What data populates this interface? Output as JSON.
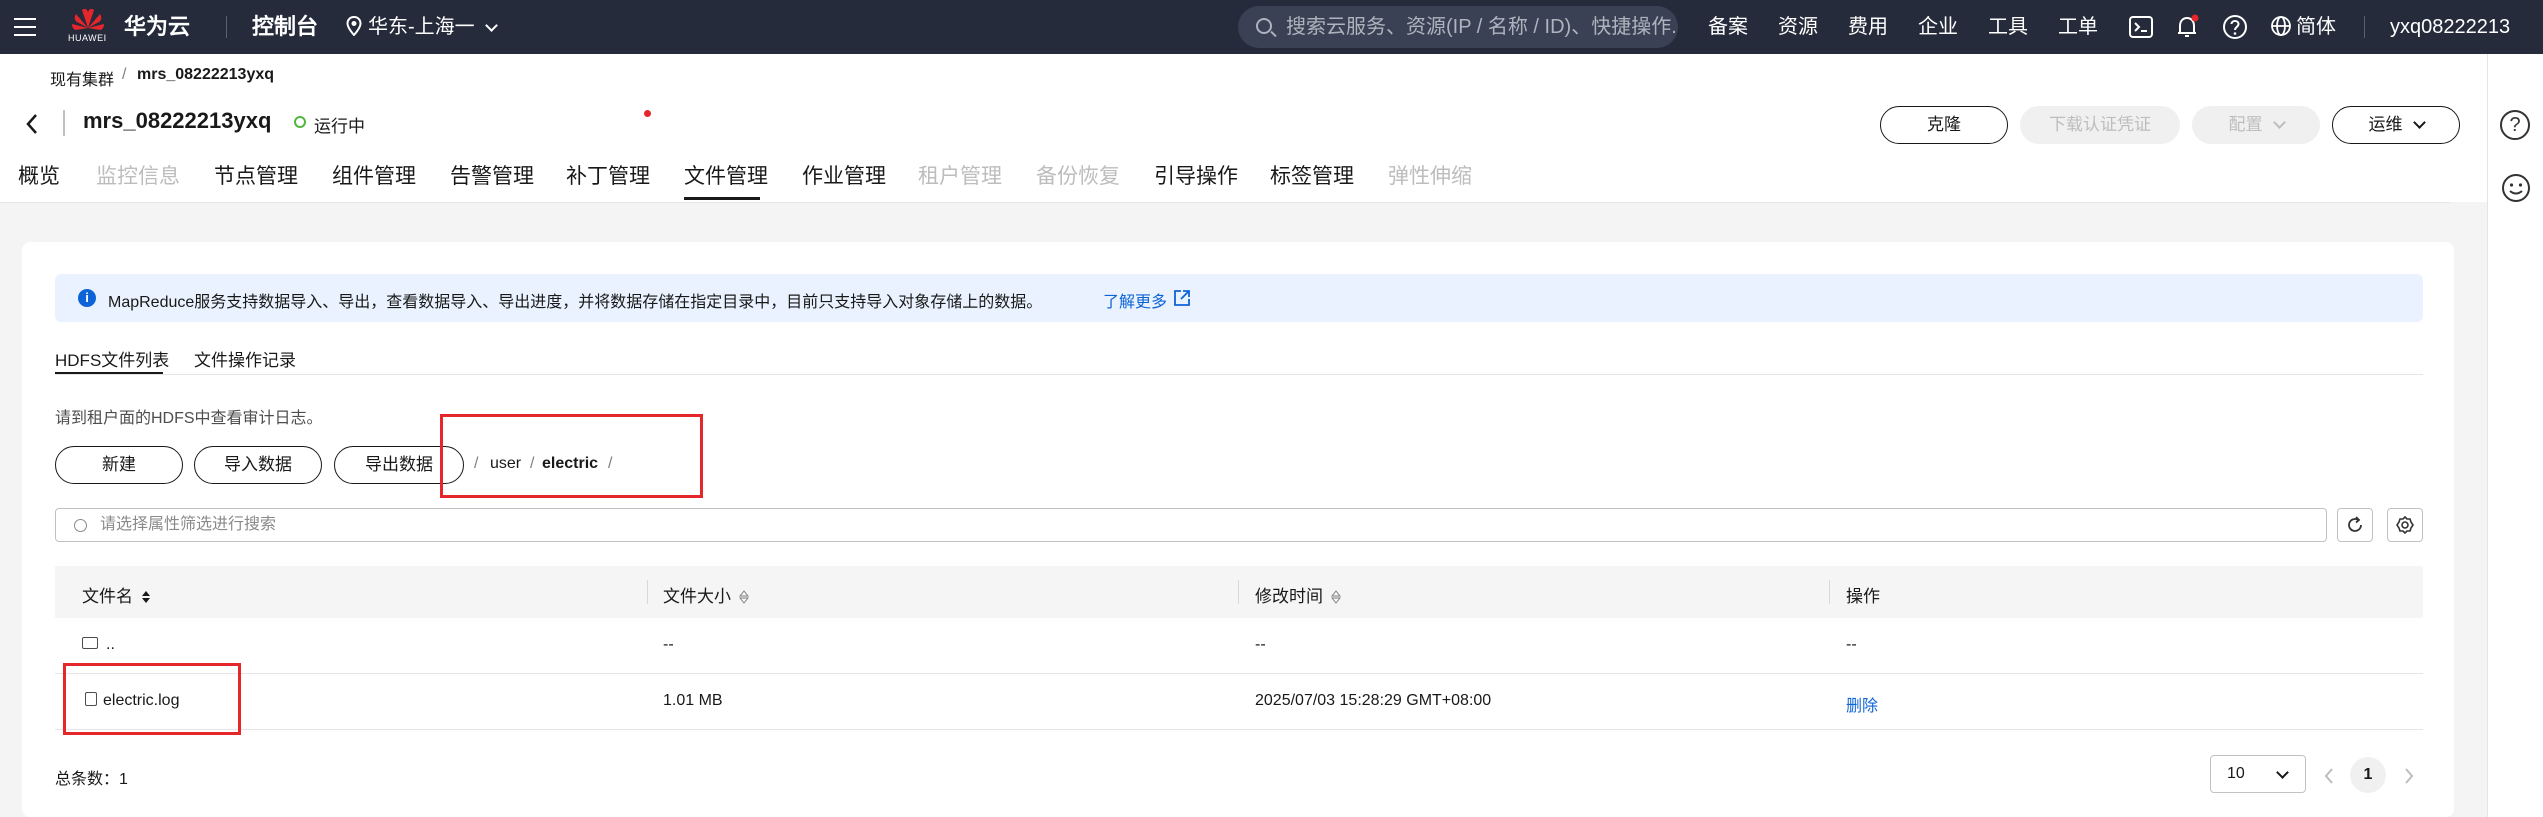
{
  "topbar": {
    "logo_text": "HUAWEI",
    "brand": "华为云",
    "console": "控制台",
    "region": "华东-上海一",
    "search_placeholder": "搜索云服务、资源(IP / 名称 / ID)、快捷操作...",
    "nav": [
      "备案",
      "资源",
      "费用",
      "企业",
      "工具",
      "工单"
    ],
    "lang": "简体",
    "username": "yxq08222213",
    "notification_color": "#e5262a"
  },
  "breadcrumb": {
    "parent": "现有集群",
    "separator": "/",
    "current": "mrs_08222213yxq"
  },
  "cluster": {
    "name": "mrs_08222213yxq",
    "status": "运行中",
    "status_color": "#50b83c"
  },
  "actions": {
    "clone": "克隆",
    "download_cert": "下载认证凭证",
    "config": "配置",
    "ops": "运维"
  },
  "tabs": [
    {
      "label": "概览",
      "state": "normal"
    },
    {
      "label": "监控信息",
      "state": "disabled"
    },
    {
      "label": "节点管理",
      "state": "normal"
    },
    {
      "label": "组件管理",
      "state": "normal"
    },
    {
      "label": "告警管理",
      "state": "normal"
    },
    {
      "label": "补丁管理",
      "state": "normal",
      "badge": true
    },
    {
      "label": "文件管理",
      "state": "active"
    },
    {
      "label": "作业管理",
      "state": "normal"
    },
    {
      "label": "租户管理",
      "state": "disabled"
    },
    {
      "label": "备份恢复",
      "state": "disabled"
    },
    {
      "label": "引导操作",
      "state": "normal"
    },
    {
      "label": "标签管理",
      "state": "normal"
    },
    {
      "label": "弹性伸缩",
      "state": "disabled"
    }
  ],
  "info": {
    "text": "MapReduce服务支持数据导入、导出，查看数据导入、导出进度，并将数据存储在指定目录中，目前只支持导入对象存储上的数据。",
    "link": "了解更多",
    "accent": "#0d64d6"
  },
  "subtabs": {
    "hdfs": "HDFS文件列表",
    "log": "文件操作记录"
  },
  "hint": "请到租户面的HDFS中查看审计日志。",
  "buttons": {
    "new": "新建",
    "import": "导入数据",
    "export": "导出数据"
  },
  "path": {
    "sep": "/",
    "seg1": "user",
    "seg2": "electric"
  },
  "filter_placeholder": "请选择属性筛选进行搜索",
  "table": {
    "headers": [
      "文件名",
      "文件大小",
      "修改时间",
      "操作"
    ],
    "rows": [
      {
        "name": "..",
        "size": "--",
        "time": "--",
        "op": "--"
      },
      {
        "name": "electric.log",
        "size": "1.01 MB",
        "time": "2025/07/03 15:28:29 GMT+08:00",
        "op": "删除"
      }
    ]
  },
  "pagination": {
    "total_label": "总条数：1",
    "page_size": "10",
    "current_page": "1"
  },
  "highlight_color": "#e5262a"
}
